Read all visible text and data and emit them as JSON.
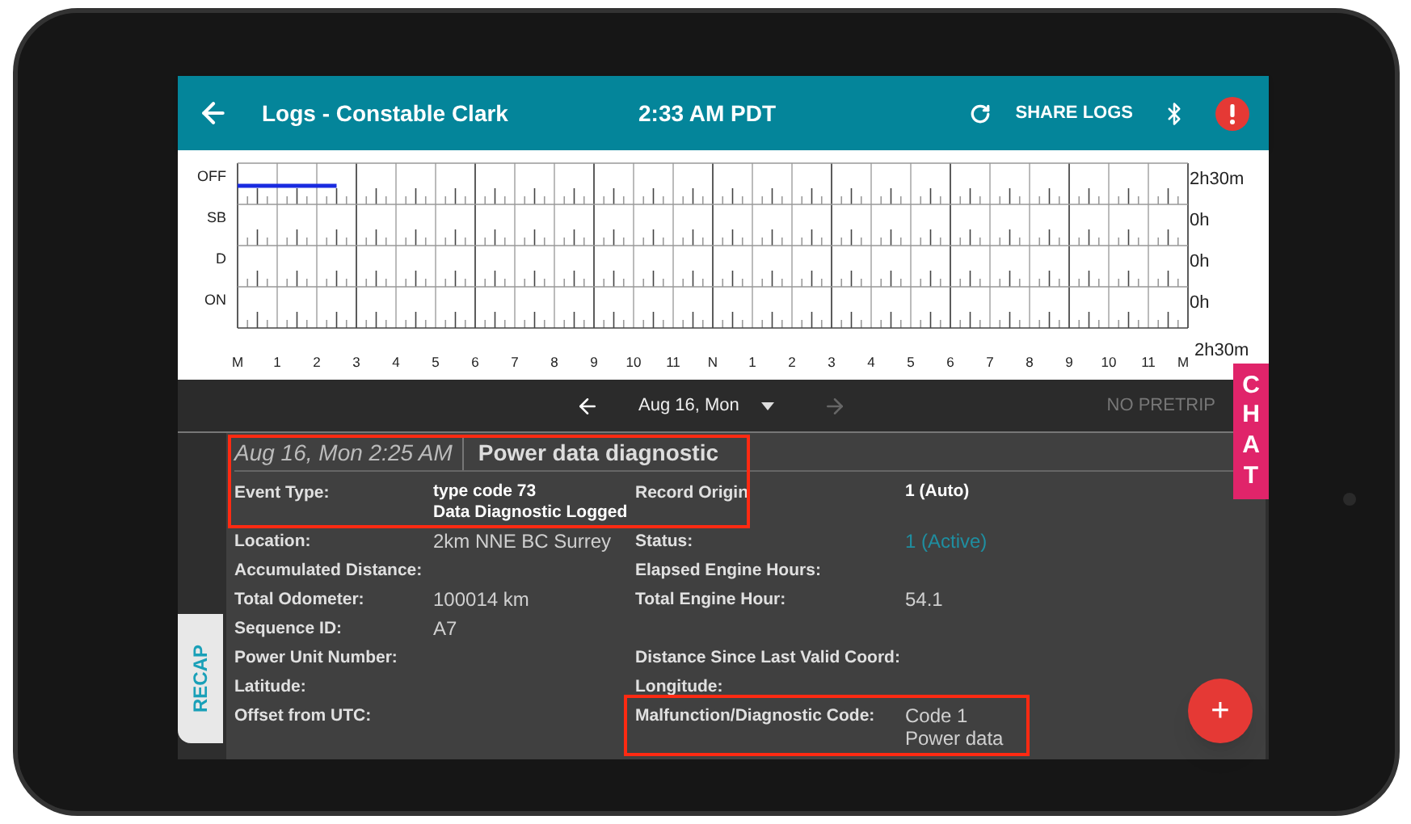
{
  "header": {
    "title": "Logs - Constable Clark",
    "time": "2:33 AM PDT",
    "share": "SHARE LOGS"
  },
  "graph": {
    "rows": [
      "OFF",
      "SB",
      "D",
      "ON"
    ],
    "hours": [
      "M",
      "1",
      "2",
      "3",
      "4",
      "5",
      "6",
      "7",
      "8",
      "9",
      "10",
      "11",
      "N",
      "1",
      "2",
      "3",
      "4",
      "5",
      "6",
      "7",
      "8",
      "9",
      "10",
      "11",
      "M"
    ],
    "totals": [
      "2h30m",
      "0h",
      "0h",
      "0h",
      "2h30m"
    ]
  },
  "date_nav": {
    "date": "Aug 16, Mon",
    "pretrip": "NO PRETRIP"
  },
  "chat": "CHAT",
  "recap": "RECAP",
  "event": {
    "time": "Aug 16, Mon 2:25 AM",
    "title": "Power data diagnostic"
  },
  "rows": [
    {
      "left": {
        "label": "Event Type:",
        "value": [
          "type code 73",
          "Data Diagnostic Logged"
        ],
        "bold": true
      },
      "right": {
        "label": "Record Origin",
        "value": [
          "1 (Auto)"
        ],
        "bold": true
      }
    },
    {
      "left": {
        "label": "Location:",
        "value": [
          "2km NNE BC Surrey"
        ],
        "bold": false
      },
      "right": {
        "label": "Status:",
        "value": [
          "1 (Active)"
        ],
        "bold": false,
        "color": "#1f8ea0"
      }
    },
    {
      "left": {
        "label": "Accumulated Distance:"
      },
      "right": {
        "label": "Elapsed Engine Hours:"
      }
    },
    {
      "left": {
        "label": "Total Odometer:",
        "value": [
          "100014 km"
        ],
        "bold": false
      },
      "right": {
        "label": "Total Engine Hour:",
        "value": [
          "54.1"
        ],
        "bold": false
      }
    },
    {
      "left": {
        "label": "Sequence ID:",
        "value": [
          "A7"
        ],
        "bold": false
      }
    },
    {
      "left": {
        "label": "Power Unit Number:"
      },
      "right": {
        "label": "Distance Since Last Valid Coord:"
      }
    },
    {
      "left": {
        "label": "Latitude:"
      },
      "right": {
        "label": "Longitude:"
      }
    },
    {
      "left": {
        "label": "Offset from UTC:"
      },
      "right": {
        "label": "Malfunction/Diagnostic Code:",
        "value": [
          "Code 1",
          "Power data"
        ],
        "bold": false
      }
    }
  ],
  "fab": "+"
}
